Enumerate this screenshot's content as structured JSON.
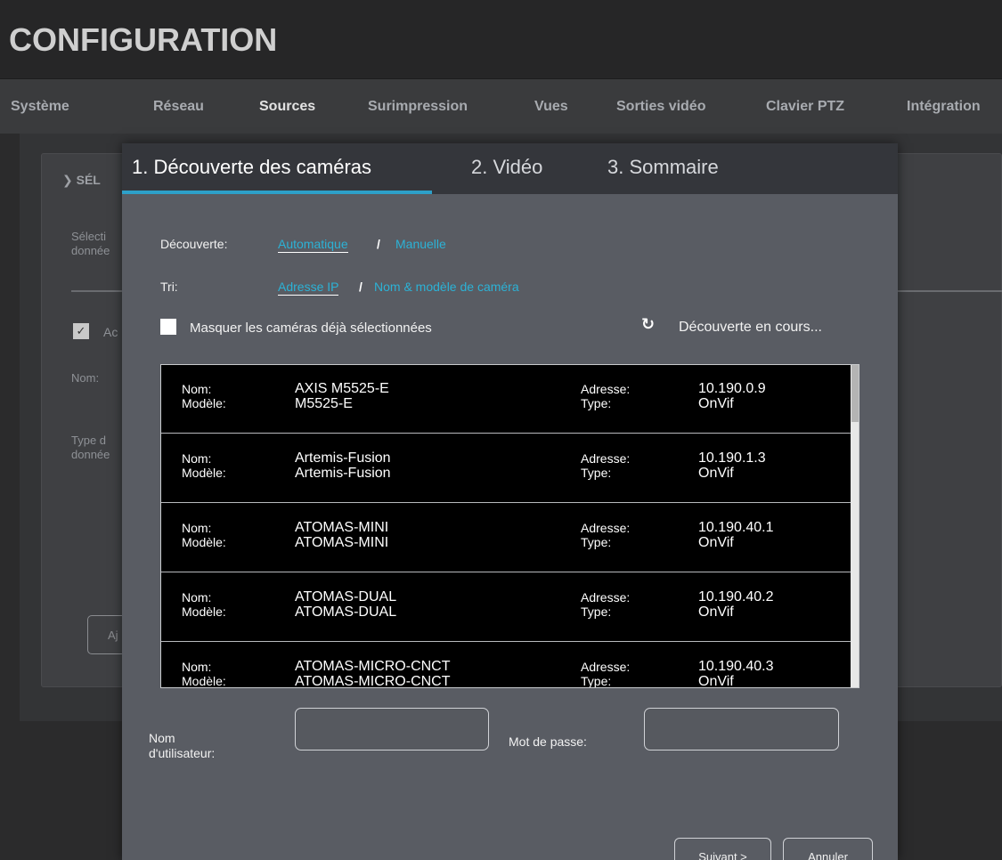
{
  "header": {
    "title": "CONFIGURATION"
  },
  "nav": {
    "tabs": [
      {
        "label": "Système"
      },
      {
        "label": "Réseau"
      },
      {
        "label": "Sources",
        "active": true
      },
      {
        "label": "Surimpression"
      },
      {
        "label": "Vues"
      },
      {
        "label": "Sorties vidéo"
      },
      {
        "label": "Clavier PTZ"
      },
      {
        "label": "Intégration"
      }
    ]
  },
  "background": {
    "section_label": "SÉL",
    "select_label_1": "Sélecti",
    "select_label_2": "donnée",
    "active_label": "Ac",
    "name_label": "Nom:",
    "type_label_1": "Type d",
    "type_label_2": "donnée",
    "button_label": "Aj"
  },
  "wizard": {
    "tabs": [
      {
        "label": "1. Découverte des caméras",
        "active": true
      },
      {
        "label": "2. Vidéo"
      },
      {
        "label": "3. Sommaire"
      }
    ],
    "discovery": {
      "label": "Découverte:",
      "options": [
        {
          "label": "Automatique",
          "selected": true
        },
        {
          "label": "Manuelle"
        }
      ],
      "separator": "/"
    },
    "sort": {
      "label": "Tri:",
      "options": [
        {
          "label": "Adresse IP",
          "selected": true
        },
        {
          "label": "Nom & modèle de caméra"
        }
      ],
      "separator": "/"
    },
    "hide_selected_label": "Masquer les caméras déjà sélectionnées",
    "status": "Découverte en cours...",
    "labels": {
      "name": "Nom:",
      "model": "Modèle:",
      "address": "Adresse:",
      "type": "Type:"
    },
    "cameras": [
      {
        "name": "AXIS M5525-E",
        "model": "M5525-E",
        "address": "10.190.0.9",
        "type": "OnVif"
      },
      {
        "name": "Artemis-Fusion",
        "model": "Artemis-Fusion",
        "address": "10.190.1.3",
        "type": "OnVif"
      },
      {
        "name": "ATOMAS-MINI",
        "model": "ATOMAS-MINI",
        "address": "10.190.40.1",
        "type": "OnVif"
      },
      {
        "name": "ATOMAS-DUAL",
        "model": "ATOMAS-DUAL",
        "address": "10.190.40.2",
        "type": "OnVif"
      },
      {
        "name": "ATOMAS-MICRO-CNCT",
        "model": "ATOMAS-MICRO-CNCT",
        "address": "10.190.40.3",
        "type": "OnVif"
      }
    ],
    "credentials": {
      "username_label_1": "Nom",
      "username_label_2": "d'utilisateur:",
      "username_value": "",
      "password_label": "Mot de passe:",
      "password_value": ""
    },
    "buttons": {
      "next": "Suivant >",
      "cancel": "Annuler"
    }
  }
}
